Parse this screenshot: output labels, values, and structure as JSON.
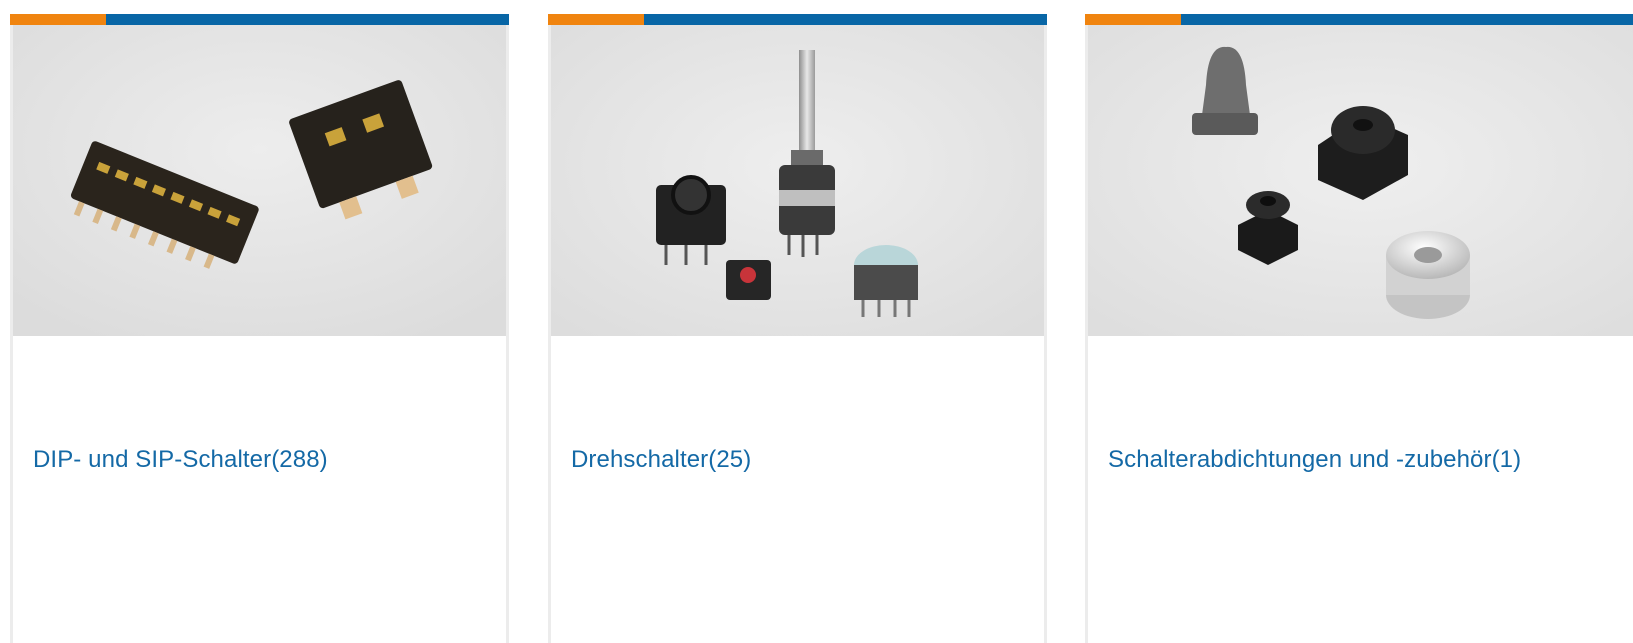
{
  "colors": {
    "accent_orange": "#F0840F",
    "accent_blue": "#0866A6",
    "link": "#1469A6"
  },
  "categories": [
    {
      "name": "DIP- und SIP-Schalter",
      "count": "(288)",
      "image": "dip-sip-switch-photo"
    },
    {
      "name": "Drehschalter",
      "count": "(25)",
      "image": "rotary-switch-photo"
    },
    {
      "name": "Schalterabdichtungen und -zubehör",
      "count": "(1)",
      "image": "switch-seal-accessory-photo"
    }
  ]
}
